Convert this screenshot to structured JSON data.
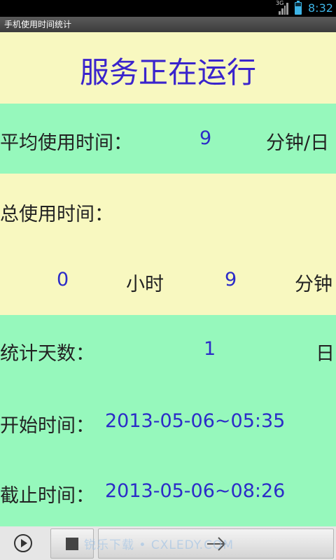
{
  "status_bar": {
    "network": "3G",
    "time": "8:32",
    "accent_color": "#3db4e6"
  },
  "app": {
    "title": "手机使用时间统计"
  },
  "service_status": "服务正在运行",
  "average": {
    "label": "平均使用时间：",
    "value": "9",
    "unit": "分钟/日"
  },
  "total": {
    "label": "总使用时间：",
    "hours": "0",
    "hours_unit": "小时",
    "minutes": "9",
    "minutes_unit": "分钟"
  },
  "days": {
    "label": "统计天数：",
    "value": "1",
    "unit": "日"
  },
  "start": {
    "label": "开始时间：",
    "value": "2013-05-06~05:35"
  },
  "end": {
    "label": "截止时间：",
    "value": "2013-05-06~08:26"
  },
  "toolbar": {
    "play_icon": "play-icon",
    "stop_icon": "stop-icon",
    "arrow_icon": "arrow-right-icon"
  },
  "watermark": "锐乐下载 • CXLEDY.COM",
  "colors": {
    "yellow_band": "#f8f8c0",
    "green_band": "#96f8bc",
    "value_text": "#2c2cc8",
    "service_text": "#3a24cc"
  }
}
